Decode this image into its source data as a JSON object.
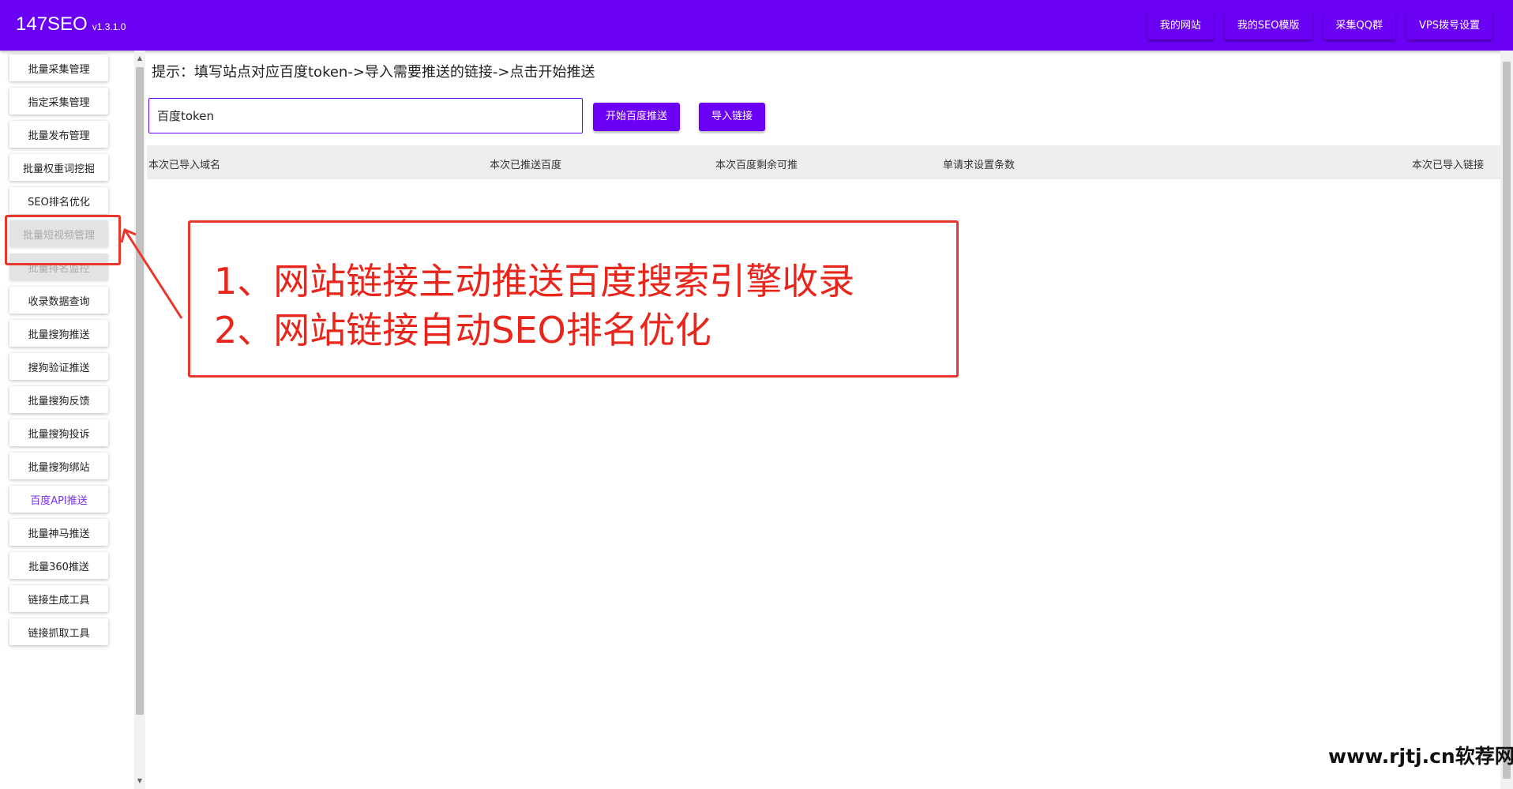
{
  "header": {
    "brand": "147SEO",
    "version": "v1.3.1.0",
    "nav": [
      "我的网站",
      "我的SEO模版",
      "采集QQ群",
      "VPS拨号设置"
    ]
  },
  "sidebar": {
    "items": [
      {
        "label": "批量采集管理",
        "state": "normal"
      },
      {
        "label": "指定采集管理",
        "state": "normal"
      },
      {
        "label": "批量发布管理",
        "state": "normal"
      },
      {
        "label": "批量权重词挖掘",
        "state": "normal"
      },
      {
        "label": "SEO排名优化",
        "state": "normal"
      },
      {
        "label": "批量短视频管理",
        "state": "disabled"
      },
      {
        "label": "批量排名监控",
        "state": "disabled"
      },
      {
        "label": "收录数据查询",
        "state": "normal"
      },
      {
        "label": "批量搜狗推送",
        "state": "normal"
      },
      {
        "label": "搜狗验证推送",
        "state": "normal"
      },
      {
        "label": "批量搜狗反馈",
        "state": "normal"
      },
      {
        "label": "批量搜狗投诉",
        "state": "normal"
      },
      {
        "label": "批量搜狗绑站",
        "state": "normal"
      },
      {
        "label": "百度API推送",
        "state": "active"
      },
      {
        "label": "批量神马推送",
        "state": "normal"
      },
      {
        "label": "批量360推送",
        "state": "normal"
      },
      {
        "label": "链接生成工具",
        "state": "normal"
      },
      {
        "label": "链接抓取工具",
        "state": "normal"
      }
    ]
  },
  "main": {
    "hint": "提示：填写站点对应百度token->导入需要推送的链接->点击开始推送",
    "token_input": {
      "value": "百度token",
      "placeholder": "百度token"
    },
    "buttons": {
      "start": "开始百度推送",
      "import": "导入链接"
    },
    "table_headers": [
      "本次已导入域名",
      "本次已推送百度",
      "本次百度剩余可推",
      "单请求设置条数",
      "本次已导入链接"
    ]
  },
  "annotation": {
    "lines": [
      "1、网站链接主动推送百度搜索引擎收录",
      "2、网站链接自动SEO排名优化"
    ]
  },
  "watermark": "www.rjtj.cn软荐网",
  "colors": {
    "accent": "#6a00f4",
    "annotation_red": "#e8372c",
    "active_item": "#7b2ff2"
  }
}
